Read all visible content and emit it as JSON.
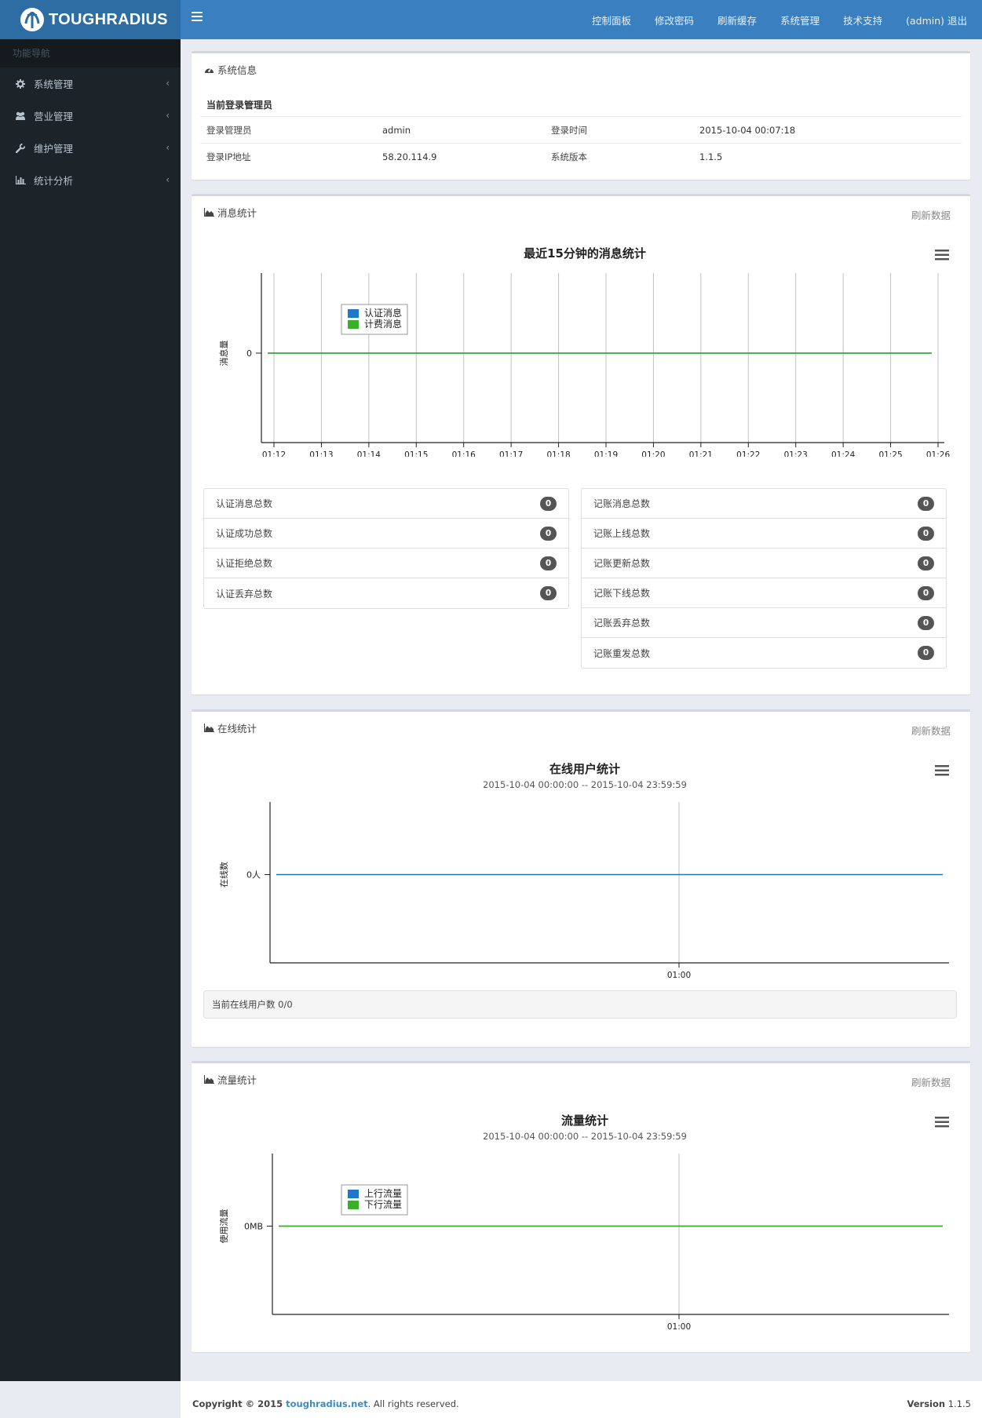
{
  "brand": {
    "name": "TOUGHRADIUS"
  },
  "sidebar": {
    "header": "功能导航",
    "items": [
      {
        "label": "系统管理",
        "icon": "gear-icon"
      },
      {
        "label": "营业管理",
        "icon": "users-icon"
      },
      {
        "label": "维护管理",
        "icon": "wrench-icon"
      },
      {
        "label": "统计分析",
        "icon": "bar-chart-icon"
      }
    ]
  },
  "topnav": {
    "items": [
      "控制面板",
      "修改密码",
      "刷新缓存",
      "系统管理",
      "技术支持",
      "(admin) 退出"
    ]
  },
  "sysinfo": {
    "title": "系统信息",
    "subtitle": "当前登录管理员",
    "rows": [
      {
        "k1": "登录管理员",
        "v1": "admin",
        "k2": "登录时间",
        "v2": "2015-10-04 00:07:18"
      },
      {
        "k1": "登录IP地址",
        "v1": "58.20.114.9",
        "k2": "系统版本",
        "v2": "1.1.5"
      }
    ]
  },
  "msgstat": {
    "title": "消息统计",
    "refresh": "刷新数据",
    "auth_list": [
      {
        "label": "认证消息总数",
        "value": "0"
      },
      {
        "label": "认证成功总数",
        "value": "0"
      },
      {
        "label": "认证拒绝总数",
        "value": "0"
      },
      {
        "label": "认证丢弃总数",
        "value": "0"
      }
    ],
    "acct_list": [
      {
        "label": "记账消息总数",
        "value": "0"
      },
      {
        "label": "记账上线总数",
        "value": "0"
      },
      {
        "label": "记账更新总数",
        "value": "0"
      },
      {
        "label": "记账下线总数",
        "value": "0"
      },
      {
        "label": "记账丢弃总数",
        "value": "0"
      },
      {
        "label": "记账重发总数",
        "value": "0"
      }
    ]
  },
  "onlinestat": {
    "title": "在线统计",
    "refresh": "刷新数据",
    "current": "当前在线用户数 0/0"
  },
  "flowstat": {
    "title": "流量统计",
    "refresh": "刷新数据"
  },
  "footer": {
    "copyright": "Copyright © 2015 ",
    "site": "toughradius.net",
    "rights": ". All rights reserved.",
    "version_label": "Version",
    "version": "1.1.5"
  },
  "colors": {
    "series_blue": "#1f77c9",
    "series_green": "#3ab02a",
    "topbar": "#3a7fbf",
    "sidebar": "#1c2329"
  },
  "chart_data": [
    {
      "type": "line",
      "title": "最近15分钟的消息统计",
      "ylabel": "消息量",
      "x": [
        "01:12",
        "01:13",
        "01:14",
        "01:15",
        "01:16",
        "01:17",
        "01:18",
        "01:19",
        "01:20",
        "01:21",
        "01:22",
        "01:23",
        "01:24",
        "01:25",
        "01:26"
      ],
      "y_ticks": [
        "0"
      ],
      "legend_position": "top-left",
      "grid": "vertical",
      "series": [
        {
          "name": "认证消息",
          "color": "#1f77c9",
          "values": [
            0,
            0,
            0,
            0,
            0,
            0,
            0,
            0,
            0,
            0,
            0,
            0,
            0,
            0,
            0
          ]
        },
        {
          "name": "计费消息",
          "color": "#3ab02a",
          "values": [
            0,
            0,
            0,
            0,
            0,
            0,
            0,
            0,
            0,
            0,
            0,
            0,
            0,
            0,
            0
          ]
        }
      ]
    },
    {
      "type": "line",
      "title": "在线用户统计",
      "subtitle": "2015-10-04 00:00:00 -- 2015-10-04 23:59:59",
      "ylabel": "在线数",
      "x_ticks": [
        "01:00"
      ],
      "y_ticks": [
        "0人"
      ],
      "grid": "vertical",
      "series": [
        {
          "color": "#1f77c9",
          "values": [
            0,
            0
          ]
        }
      ]
    },
    {
      "type": "line",
      "title": "流量统计",
      "subtitle": "2015-10-04 00:00:00 -- 2015-10-04 23:59:59",
      "ylabel": "使用流量",
      "x_ticks": [
        "01:00"
      ],
      "y_ticks": [
        "0MB"
      ],
      "legend_position": "top-left",
      "grid": "vertical",
      "series": [
        {
          "name": "上行流量",
          "color": "#1f77c9",
          "values": [
            0,
            0
          ]
        },
        {
          "name": "下行流量",
          "color": "#3ab02a",
          "values": [
            0,
            0
          ]
        }
      ]
    }
  ]
}
